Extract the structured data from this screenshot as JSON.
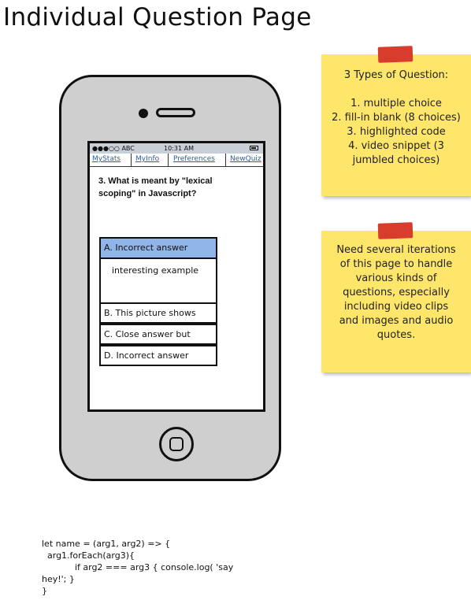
{
  "title": "Individual Question Page",
  "phone": {
    "status": {
      "carrier": "●●●○○ ABC",
      "time": "10:31 AM"
    },
    "nav": [
      "MyStats",
      "MyInfo",
      "Preferences",
      "NewQuiz"
    ],
    "question": "3.  What is meant by \"lexical scoping\" in Javascript?",
    "answers": {
      "a": "A. Incorrect answer",
      "a_detail": "interesting example",
      "b": "B. This picture shows",
      "c": "C. Close answer but",
      "d": "D. Incorrect answer"
    }
  },
  "notes": {
    "types": [
      "3 Types of Question:",
      "",
      "1. multiple choice",
      "2. fill-in blank (8 choices)",
      "3. highlighted code",
      "4. video snippet (3 jumbled choices)"
    ],
    "iterations": "Need several iterations of this page to handle various kinds of questions, especially including video clips and images and audio quotes."
  },
  "code": [
    "let name = (arg1, arg2) => {",
    "  arg1.forEach(arg3){",
    "            if arg2 === arg3 { console.log( 'say",
    "hey!'; }",
    "}"
  ],
  "colors": {
    "selected_answer": "#8fb5e9",
    "sticky_note": "#fde66a",
    "tape": "#d83c2c",
    "phone_body": "#cfcfcf"
  }
}
